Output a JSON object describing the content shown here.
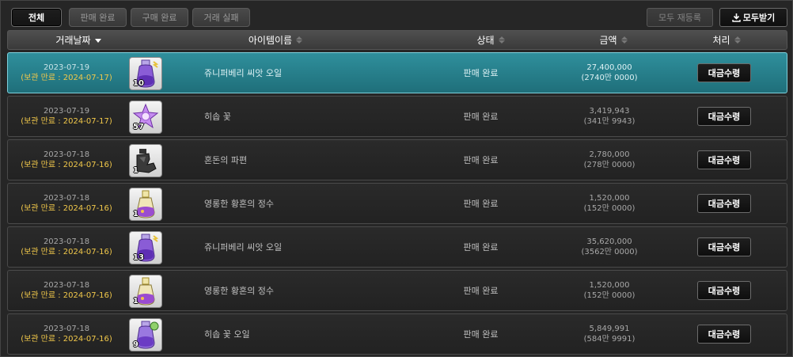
{
  "tabs": [
    {
      "label": "전체",
      "active": true
    },
    {
      "label": "판매 완료",
      "active": false
    },
    {
      "label": "구매 완료",
      "active": false
    },
    {
      "label": "거래 실패",
      "active": false
    }
  ],
  "toolbar": {
    "reregister_all_label": "모두 재등록",
    "receive_all_label": "모두받기",
    "receive_all_icon": "download-icon"
  },
  "columns": {
    "date": "거래날짜",
    "item_name": "아이템이름",
    "status": "상태",
    "amount": "금액",
    "action": "처리"
  },
  "colors": {
    "selected_row": "#2a8592",
    "expire_text": "#f1c84a",
    "background": "#262626"
  },
  "rows": [
    {
      "date": "2023-07-19",
      "expire": "(보관 만료 : 2024-07-17)",
      "icon": "juniper-seed-oil-icon",
      "qty": "10",
      "name": "쥬니퍼베리 씨앗 오일",
      "status": "판매 완료",
      "price": "27,400,000",
      "price_kr": "(2740만 0000)",
      "action": "대금수령",
      "selected": true
    },
    {
      "date": "2023-07-19",
      "expire": "(보관 만료 : 2024-07-17)",
      "icon": "sniffing-flower-icon",
      "qty": "57",
      "name": "히솝 꽃",
      "status": "판매 완료",
      "price": "3,419,943",
      "price_kr": "(341만 9943)",
      "action": "대금수령",
      "selected": false
    },
    {
      "date": "2023-07-18",
      "expire": "(보관 만료 : 2024-07-16)",
      "icon": "chaos-fragment-icon",
      "qty": "1",
      "name": "혼돈의 파편",
      "status": "판매 완료",
      "price": "2,780,000",
      "price_kr": "(278만 0000)",
      "action": "대금수령",
      "selected": false
    },
    {
      "date": "2023-07-18",
      "expire": "(보관 만료 : 2024-07-16)",
      "icon": "twilight-essence-icon",
      "qty": "1",
      "name": "영롱한 황혼의 정수",
      "status": "판매 완료",
      "price": "1,520,000",
      "price_kr": "(152만 0000)",
      "action": "대금수령",
      "selected": false
    },
    {
      "date": "2023-07-18",
      "expire": "(보관 만료 : 2024-07-16)",
      "icon": "juniper-seed-oil-icon",
      "qty": "13",
      "name": "쥬니퍼베리 씨앗 오일",
      "status": "판매 완료",
      "price": "35,620,000",
      "price_kr": "(3562만 0000)",
      "action": "대금수령",
      "selected": false
    },
    {
      "date": "2023-07-18",
      "expire": "(보관 만료 : 2024-07-16)",
      "icon": "twilight-essence-icon",
      "qty": "1",
      "name": "영롱한 황혼의 정수",
      "status": "판매 완료",
      "price": "1,520,000",
      "price_kr": "(152만 0000)",
      "action": "대금수령",
      "selected": false
    },
    {
      "date": "2023-07-18",
      "expire": "(보관 만료 : 2024-07-16)",
      "icon": "hyssop-flower-oil-icon",
      "qty": "9",
      "name": "히솝 꽃 오일",
      "status": "판매 완료",
      "price": "5,849,991",
      "price_kr": "(584만 9991)",
      "action": "대금수령",
      "selected": false
    }
  ]
}
